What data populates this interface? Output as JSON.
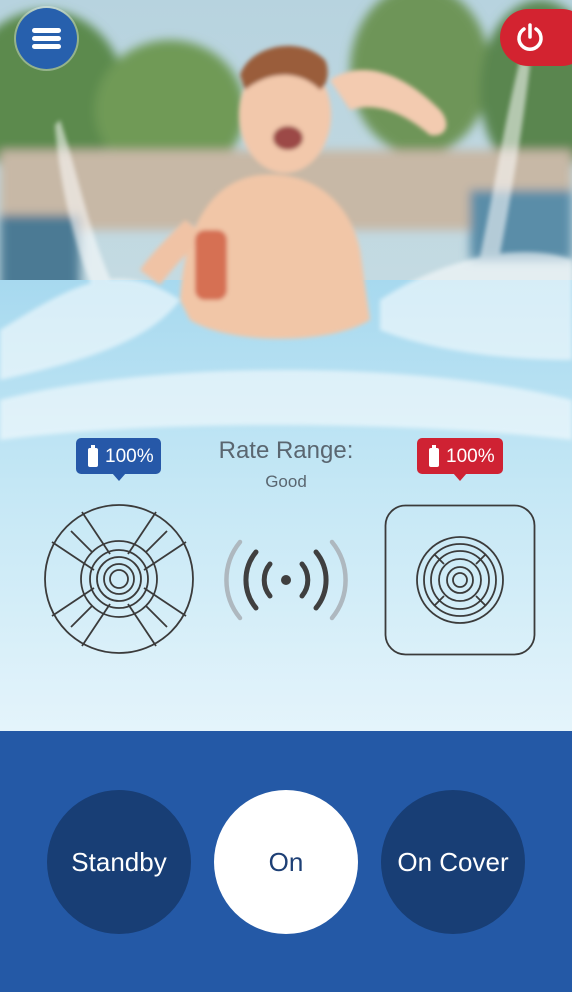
{
  "header": {
    "menu_icon": "hamburger-menu-icon",
    "power_icon": "power-icon",
    "power_color": "#d32330",
    "menu_color": "#2760ad"
  },
  "status": {
    "left_battery": {
      "label": "100%",
      "level": 1.0,
      "color": "#2658a8",
      "icon": "battery-icon"
    },
    "right_battery": {
      "label": "100%",
      "level": 1.0,
      "color": "#cf2233",
      "icon": "battery-icon"
    },
    "rate_range": {
      "title": "Rate Range:",
      "value": "Good"
    },
    "signal_icon": "wireless-signal-icon",
    "left_device_icon": "round-pool-device-icon",
    "right_device_icon": "square-pool-device-icon"
  },
  "modes": [
    {
      "label": "Standby",
      "active": false
    },
    {
      "label": "On",
      "active": true
    },
    {
      "label": "On Cover",
      "active": false
    }
  ],
  "colors": {
    "bottom_panel": "#2459a6",
    "mode_button": "#183e75"
  }
}
